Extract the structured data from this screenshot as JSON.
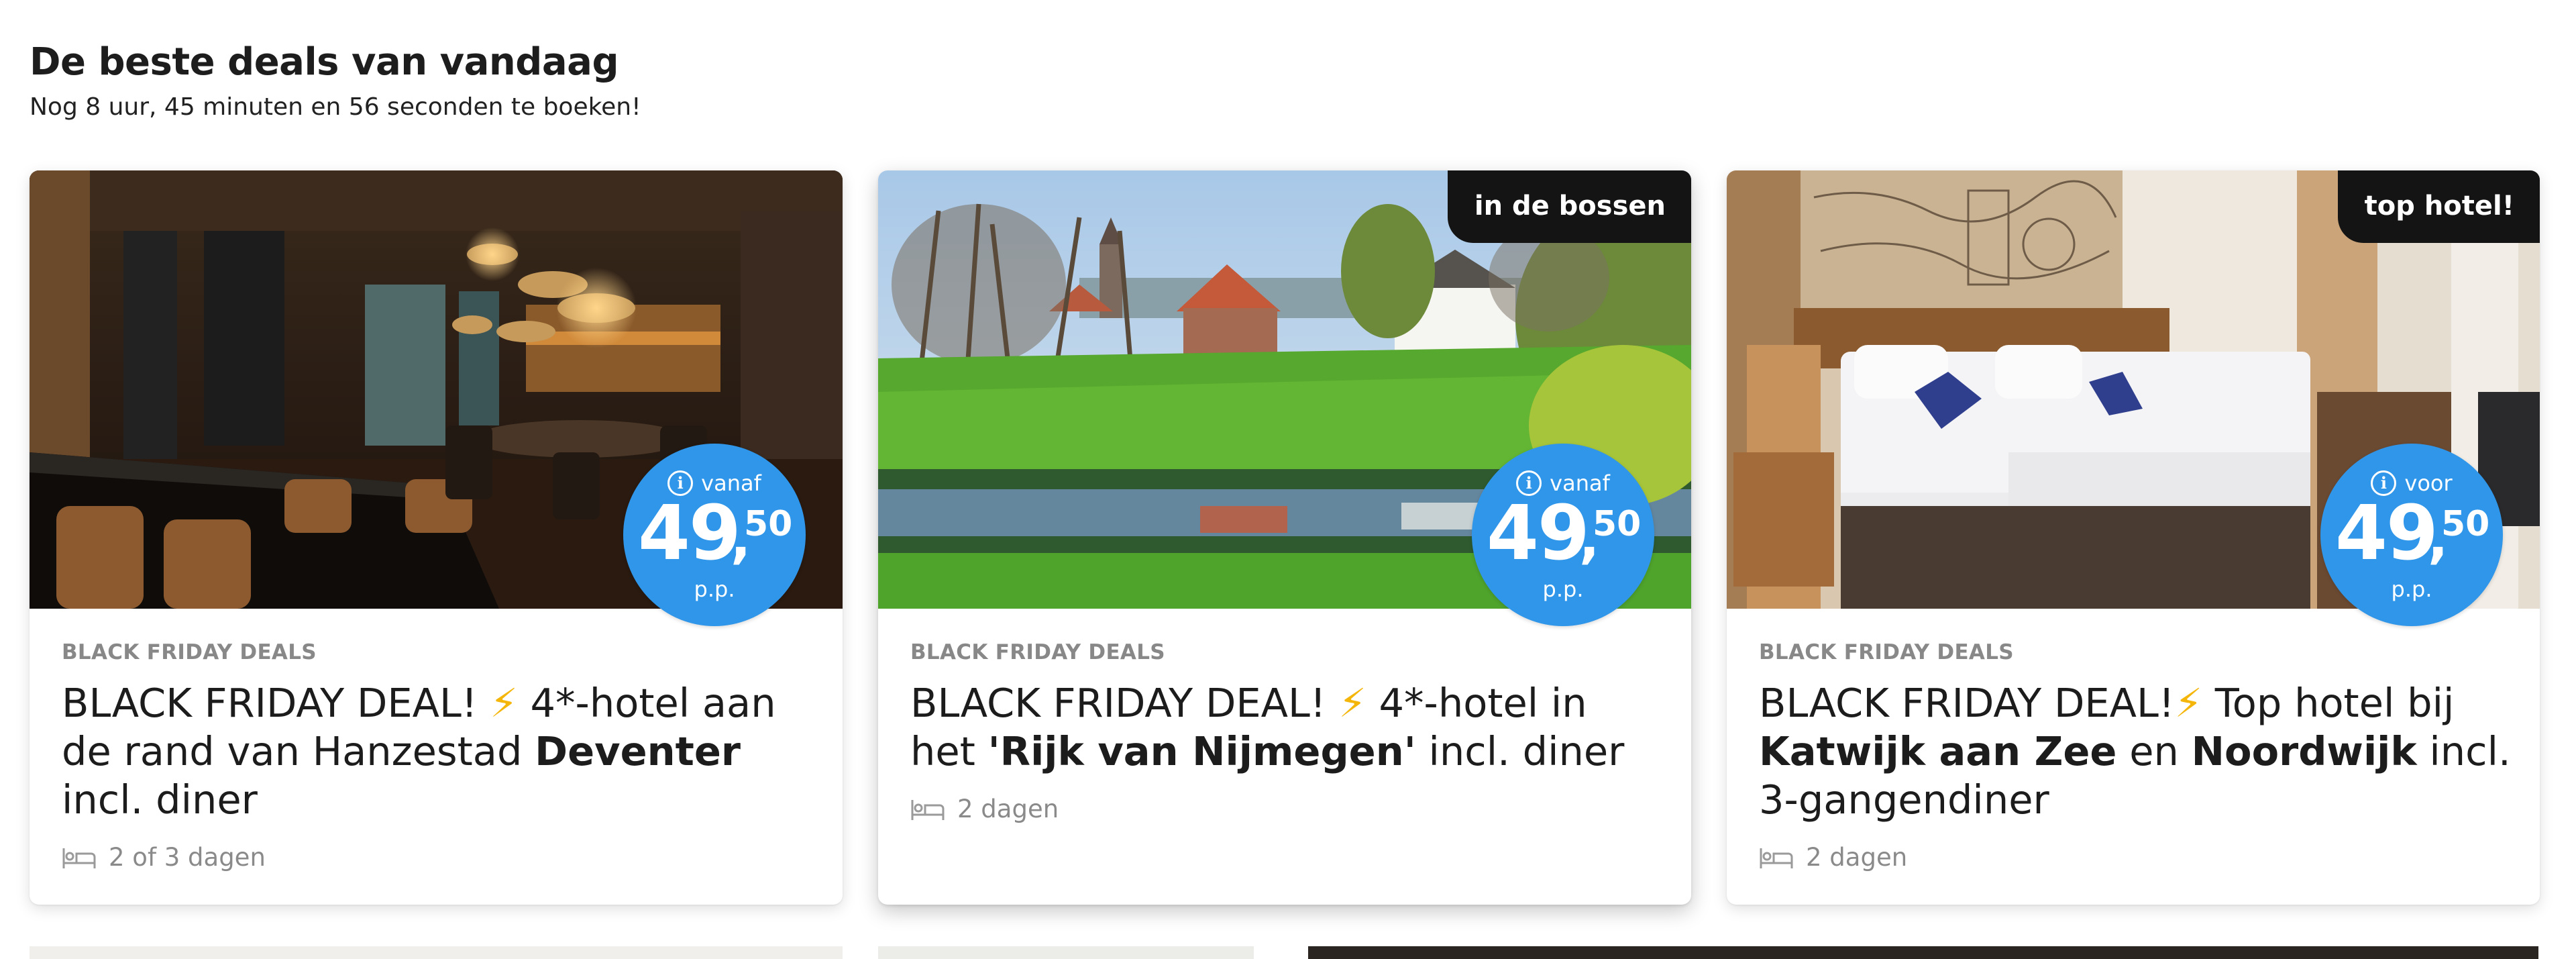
{
  "header": {
    "title": "De beste deals van vandaag",
    "subtitle": "Nog 8 uur, 45 minuten en 56 seconden te boeken!"
  },
  "cards": [
    {
      "tag": "",
      "price_prefix": "vanaf",
      "price_whole": "49",
      "price_cents": "50",
      "price_unit": "p.p.",
      "category": "BLACK FRIDAY DEALS",
      "title_1": "BLACK FRIDAY DEAL! ",
      "bolt": "⚡",
      "title_2": " 4*-hotel aan de rand van Hanzestad ",
      "title_bold_1": "Deventer",
      "title_3": " incl. diner",
      "duration": "2 of 3 dagen"
    },
    {
      "tag": "in de bossen",
      "price_prefix": "vanaf",
      "price_whole": "49",
      "price_cents": "50",
      "price_unit": "p.p.",
      "category": "BLACK FRIDAY DEALS",
      "title_1": "BLACK FRIDAY DEAL! ",
      "bolt": "⚡",
      "title_2": " 4*-hotel in het ",
      "title_bold_1": "'Rijk van Nijmegen'",
      "title_3": " incl. diner",
      "duration": "2 dagen"
    },
    {
      "tag": "top hotel!",
      "price_prefix": "voor",
      "price_whole": "49",
      "price_cents": "50",
      "price_unit": "p.p.",
      "category": "BLACK FRIDAY DEALS",
      "title_1": "BLACK FRIDAY DEAL!",
      "bolt": "⚡",
      "title_2": " Top hotel bij ",
      "title_bold_1": "Katwijk aan Zee",
      "title_mid": " en ",
      "title_bold_2": "Noordwijk",
      "title_3": " incl. 3-gangendiner",
      "duration": "2 dagen"
    }
  ],
  "colors": {
    "price_badge": "#2f96ea",
    "tag_background": "#141414",
    "bolt": "#f5b60b",
    "category": "#888888"
  },
  "icons": [
    "info-icon",
    "bed-icon",
    "lightning-icon"
  ]
}
